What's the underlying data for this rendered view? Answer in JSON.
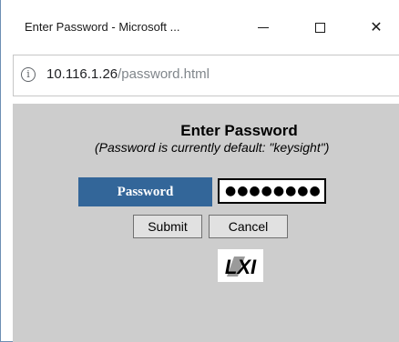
{
  "window": {
    "title": "Enter Password - Microsoft ...",
    "minimize_icon": "minimize-icon",
    "maximize_icon": "maximize-icon",
    "close_icon": "close-icon",
    "close_glyph": "✕"
  },
  "address_bar": {
    "info_glyph": "i",
    "host": "10.116.1.26",
    "path": "/password.html"
  },
  "page": {
    "title": "Enter Password",
    "subtitle": "(Password is currently default: \"keysight\")",
    "password_label": "Password",
    "password_value": "●●●●●●●●",
    "submit_label": "Submit",
    "cancel_label": "Cancel",
    "logo_text": "LXI",
    "label_bg": "#336699",
    "content_bg": "#cdcdcd"
  }
}
